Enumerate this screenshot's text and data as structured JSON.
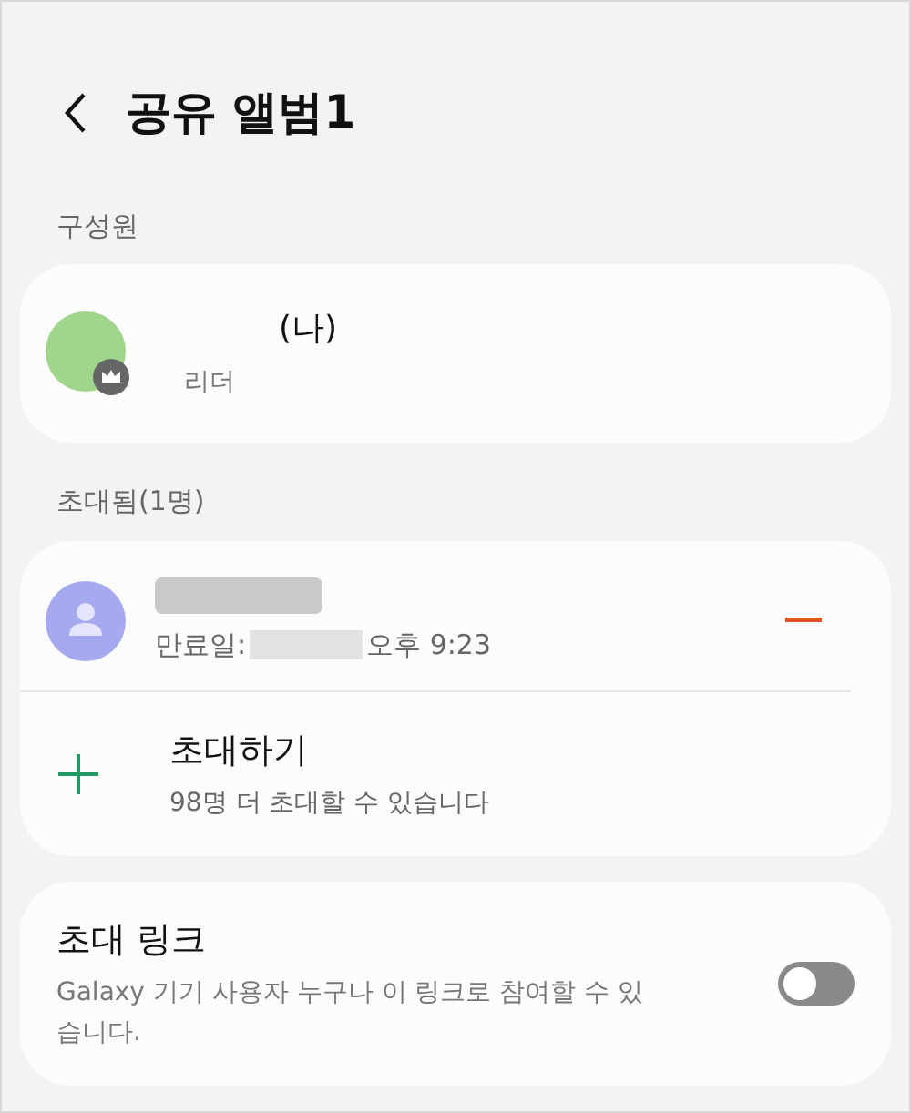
{
  "header": {
    "title": "공유 앨범1"
  },
  "members": {
    "heading": "구성원",
    "items": [
      {
        "name_suffix": "(나)",
        "role": "리더",
        "leader": true
      }
    ]
  },
  "invited": {
    "heading": "초대됨(1명)",
    "items": [
      {
        "expiry_label": "만료일:",
        "expiry_time": "오후 9:23"
      }
    ],
    "invite": {
      "label": "초대하기",
      "hint": "98명 더 초대할 수 있습니다"
    }
  },
  "invite_link": {
    "title": "초대 링크",
    "description": "Galaxy 기기 사용자 누구나 이 링크로 참여할 수 있습니다.",
    "on": false
  }
}
